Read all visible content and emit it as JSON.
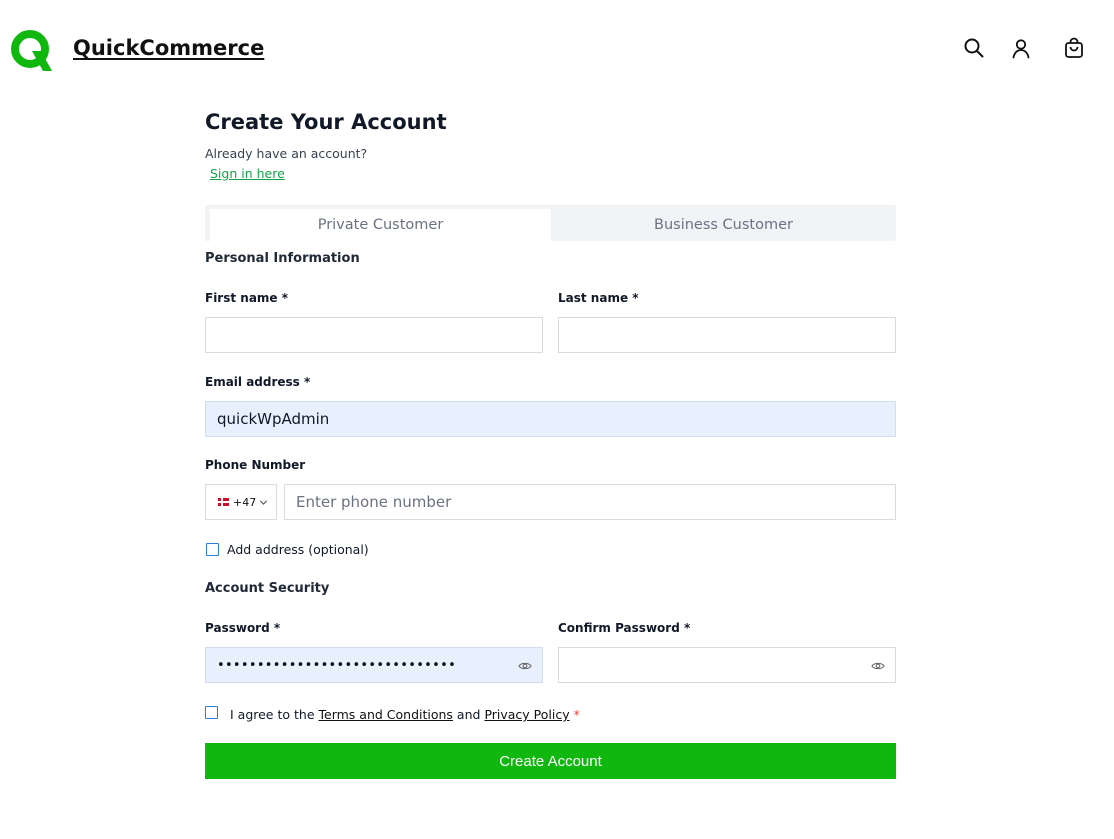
{
  "header": {
    "brand": "QuickCommerce",
    "icons": [
      "search-icon",
      "user-icon",
      "cart-icon"
    ],
    "accent_color": "#10b70f"
  },
  "page": {
    "title": "Create Your Account",
    "already_text": "Already have an account?",
    "signin_link": "Sign in here"
  },
  "tabs": [
    {
      "label": "Private Customer",
      "active": true
    },
    {
      "label": "Business Customer",
      "active": false
    }
  ],
  "personal": {
    "section_title": "Personal Information",
    "first_name_label": "First name *",
    "first_name_value": "",
    "last_name_label": "Last name *",
    "last_name_value": "",
    "email_label": "Email address *",
    "email_value": "quickWpAdmin",
    "phone_label": "Phone Number",
    "phone_code": "+47",
    "phone_placeholder": "Enter phone number",
    "add_address_label": "Add address (optional)"
  },
  "security": {
    "section_title": "Account Security",
    "password_label": "Password *",
    "password_value": "••••••••••••••••••••••••••••••",
    "confirm_label": "Confirm Password *",
    "confirm_value": ""
  },
  "agree": {
    "prefix": "I agree to the",
    "terms": "Terms and Conditions",
    "and": "and",
    "privacy": "Privacy Policy",
    "required_mark": "*"
  },
  "submit_label": "Create Account"
}
